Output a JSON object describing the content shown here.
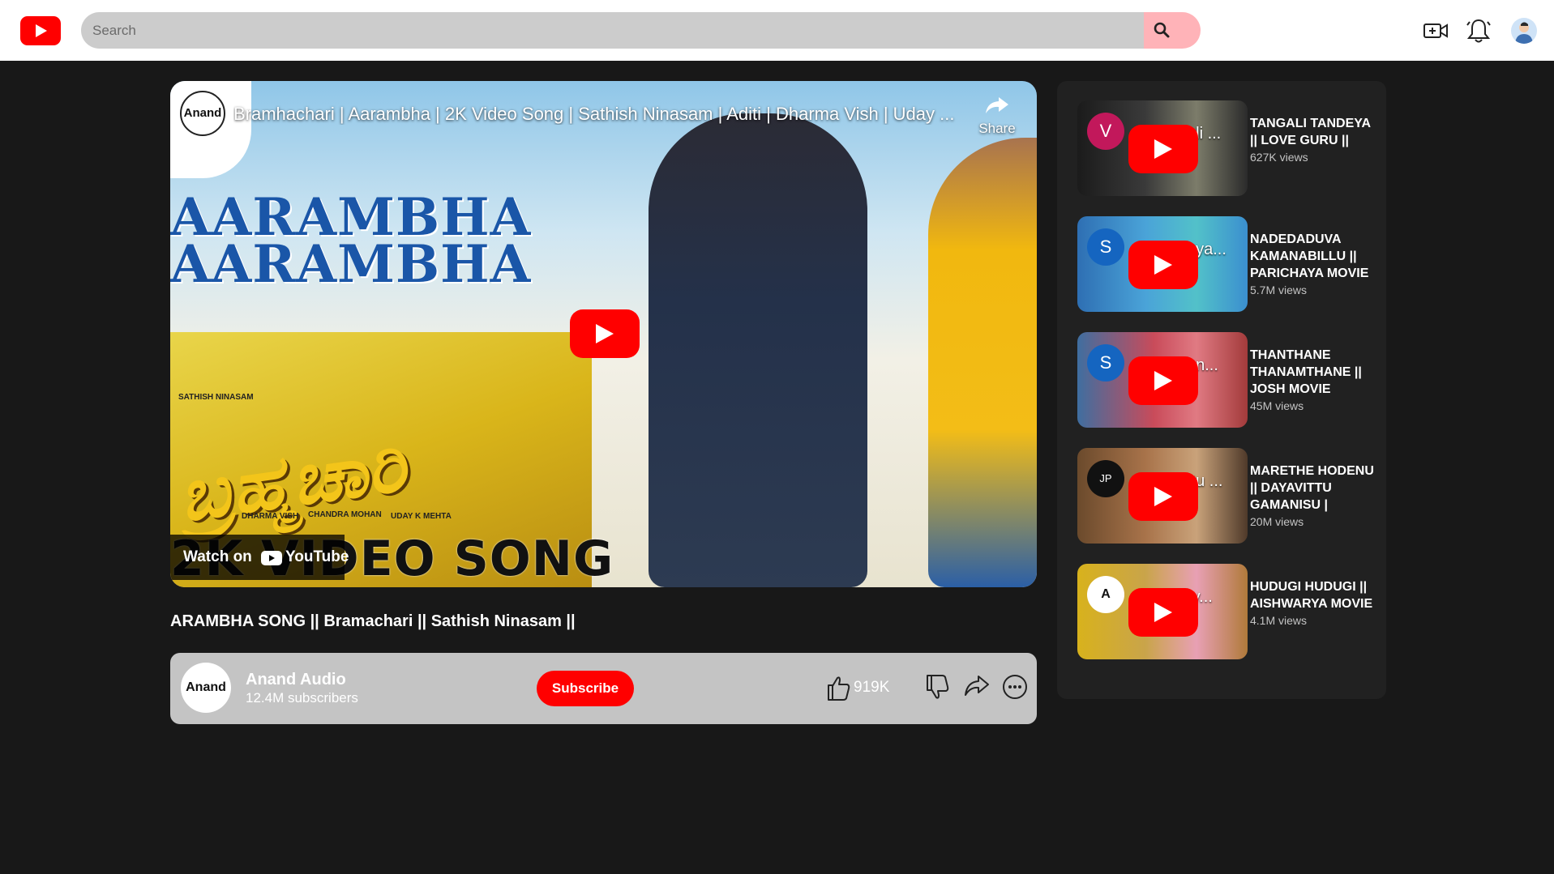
{
  "header": {
    "search_placeholder": "Search"
  },
  "player": {
    "overlay_title": "Bramhachari | Aarambha | 2K Video Song | Sathish Ninasam | Aditi | Dharma Vish | Uday ...",
    "share_label": "Share",
    "watch_on_label": "Watch on",
    "youtube_wordmark": "YouTube",
    "channel_logo_text": "Anand",
    "art": {
      "title_line1": "AARAMBHA",
      "title_line2": "AARAMBHA",
      "song_banner": "2K VIDEO SONG",
      "script_title": "ಬ್ರಹ್ಮಚಾರಿ",
      "credit_lead": "SATHISH NINASAM",
      "credit_music": "DHARMA VISH",
      "credit_director": "CHANDRA MOHAN",
      "credit_producer": "UDAY K MEHTA"
    }
  },
  "video": {
    "title": "ARAMBHA SONG || Bramachari || Sathish Ninasam ||",
    "channel_name": "Anand Audio",
    "subscribers": "12.4M subscribers",
    "subscribe_label": "Subscribe",
    "like_count": "919K",
    "channel_avatar_text": "Anand"
  },
  "recommendations": [
    {
      "title": "TANGALI TANDEYA || LOVE GURU ||",
      "views": "627K views",
      "avatar_letter": "V",
      "overlay": "ali ...",
      "avatar_color": "#c2185b"
    },
    {
      "title": "NADEDADUVA KAMANABILLU || PARICHAYA MOVIE",
      "views": "5.7M views",
      "avatar_letter": "S",
      "overlay": "aya...",
      "avatar_color": "#1565c0"
    },
    {
      "title": "THANTHANE THANAMTHANE || JOSH MOVIE",
      "views": "45M views",
      "avatar_letter": "S",
      "overlay": "an...",
      "avatar_color": "#1565c0"
    },
    {
      "title": "MARETHE HODENU || DAYAVITTU GAMANISU |",
      "views": "20M views",
      "avatar_letter": "JP",
      "overlay": "ttu ...",
      "avatar_color": "#111111"
    },
    {
      "title": "HUDUGI HUDUGI || AISHWARYA MOVIE",
      "views": "4.1M views",
      "avatar_letter": "A",
      "overlay": "ry...",
      "avatar_color": "#ffffff"
    }
  ],
  "colors": {
    "brand_red": "#ff0000",
    "page_bg": "#181818",
    "sidebar_bg": "#212121",
    "search_bg": "#cccccc",
    "search_button_bg": "#ffb3b8"
  }
}
